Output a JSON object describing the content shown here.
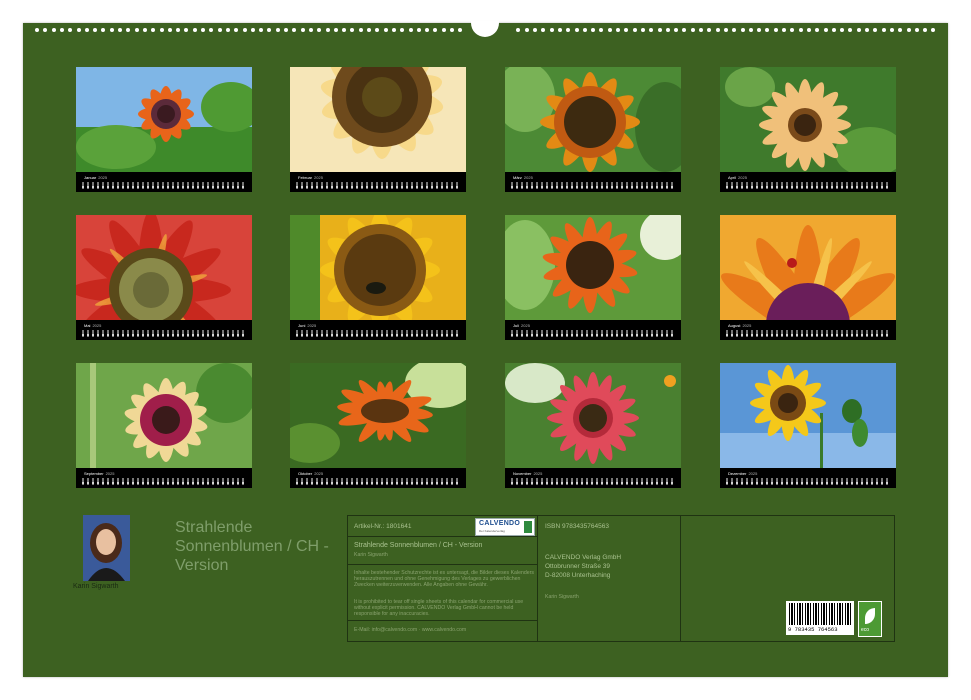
{
  "months": [
    {
      "name": "Januar",
      "year": "2025"
    },
    {
      "name": "Februar",
      "year": "2025"
    },
    {
      "name": "März",
      "year": "2025"
    },
    {
      "name": "April",
      "year": "2025"
    },
    {
      "name": "Mai",
      "year": "2025"
    },
    {
      "name": "Juni",
      "year": "2025"
    },
    {
      "name": "Juli",
      "year": "2025"
    },
    {
      "name": "August",
      "year": "2025"
    },
    {
      "name": "September",
      "year": "2025"
    },
    {
      "name": "Oktober",
      "year": "2025"
    },
    {
      "name": "November",
      "year": "2025"
    },
    {
      "name": "Dezember",
      "year": "2025"
    }
  ],
  "author": {
    "name": "Karin Sigwarth"
  },
  "big_title": "Strahlende Sonnenblumen / CH - Version",
  "info": {
    "article_no": "Artikel-Nr.: 1801641",
    "title": "Strahlende Sonnenblumen / CH - Version",
    "author": "Karin Sigwarth",
    "legal_de": "Inhalte bestehender Schutzrechte ist es untersagt, die Bilder dieses Kalenders herauszutrennen und ohne Genehmigung des Verlages zu gewerblichen Zwecken weiterzuverwenden. Alle Angaben ohne Gewähr.",
    "legal_en": "It is prohibited to tear off single sheets of this calendar for commercial use without explicit permission. CALVENDO Verlag GmbH cannot be held responsible for any inaccuracies.",
    "email": "E-Mail: info@calvendo.com · www.calvendo.com",
    "isbn": "ISBN 9783435764563",
    "publisher_lines": [
      "CALVENDO Verlag GmbH",
      "Ottobrunner Straße 39",
      "D-82008 Unterhaching"
    ],
    "photographer": "Karin Sigwarth",
    "barcode_number": "9 783435 764563",
    "brand": "CALVENDO",
    "brand_sub": "Der Kalenderverlag",
    "eco_label": "eco"
  },
  "colors": {
    "background": "#3d6121",
    "calendar_bar": "#000000",
    "box_border": "#1f3312"
  }
}
